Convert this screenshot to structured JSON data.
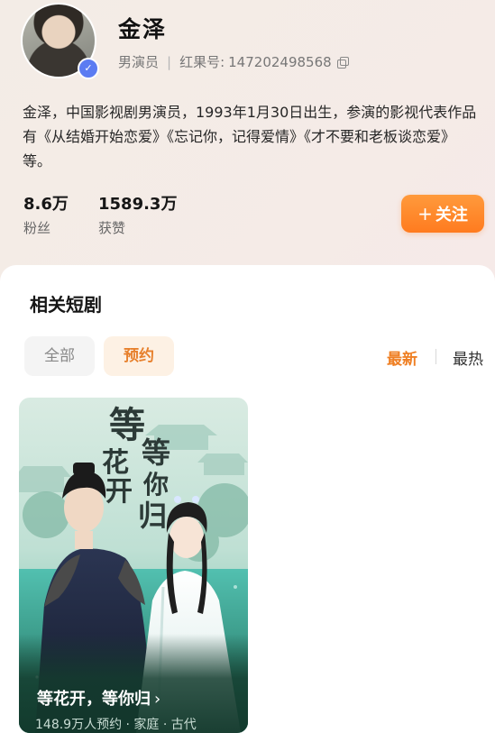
{
  "profile": {
    "name": "金泽",
    "role": "男演员",
    "id_label": "红果号:",
    "id_value": "147202498568",
    "bio": "金泽，中国影视剧男演员，1993年1月30日出生，参演的影视代表作品有《从结婚开始恋爱》《忘记你，记得爱情》《才不要和老板谈恋爱》等。",
    "stats": [
      {
        "value": "8.6万",
        "label": "粉丝"
      },
      {
        "value": "1589.3万",
        "label": "获赞"
      }
    ],
    "follow_label": "关注",
    "verified_icon": "✓"
  },
  "dramas": {
    "section_title": "相关短剧",
    "filters": [
      "全部",
      "预约"
    ],
    "active_filter": "预约",
    "sort_options": [
      "最新",
      "最热"
    ],
    "active_sort": "最新",
    "items": [
      {
        "title": "等花开，等你归",
        "subtitle": "148.9万人预约 · 家庭 · 古代",
        "poster_calligraphy": "等花开 等你归"
      }
    ]
  },
  "colors": {
    "accent": "#ff7b1f",
    "accent_text": "#ef7f23",
    "verified": "#5b7cf2"
  }
}
